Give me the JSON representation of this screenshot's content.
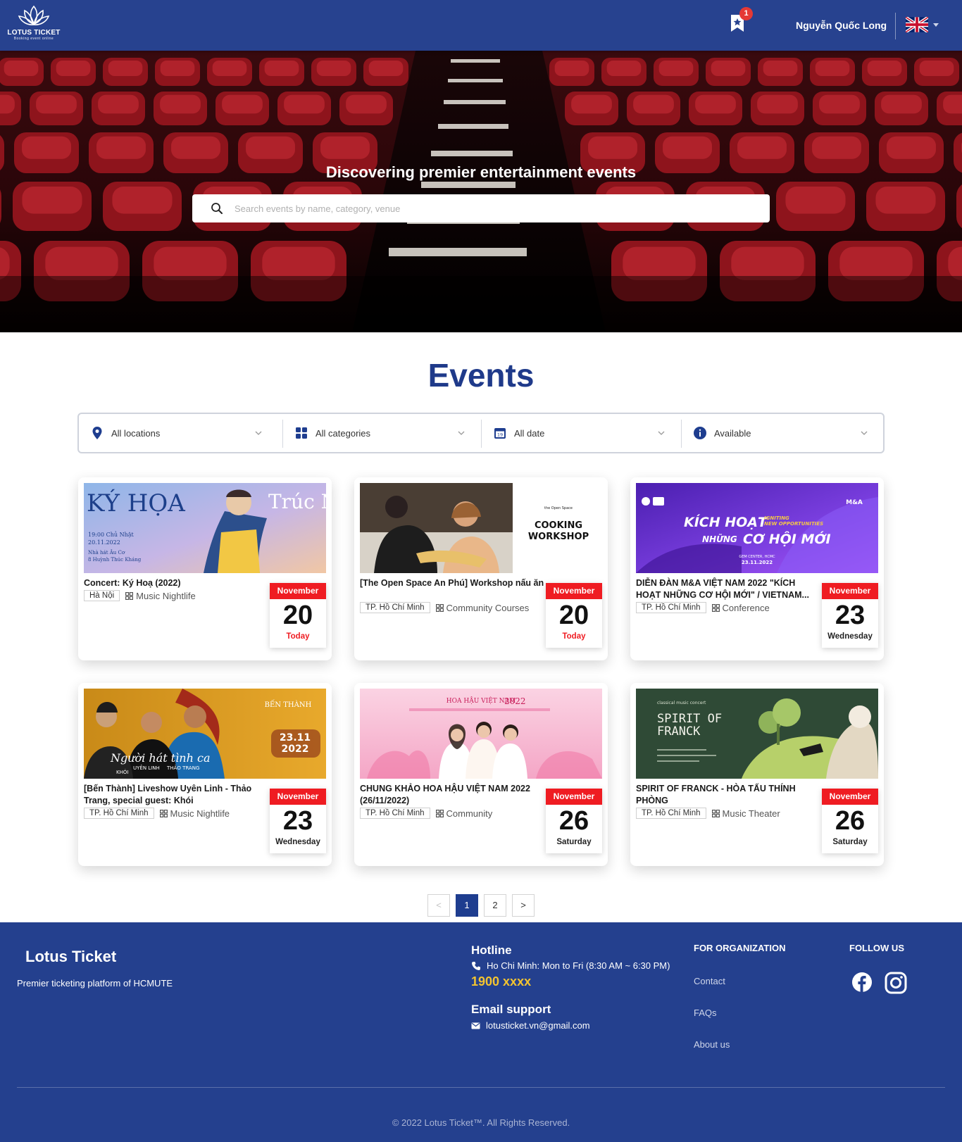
{
  "header": {
    "logo_title": "LOTUS TICKET",
    "logo_subtitle": "Booking event online",
    "wishlist_count": "1",
    "user_name": "Nguyễn Quốc Long",
    "language_icon": "uk-flag-icon"
  },
  "hero": {
    "title": "Discovering premier entertainment events",
    "search_placeholder": "Search events by name, category, venue"
  },
  "events": {
    "title": "Events",
    "filters": [
      {
        "label": "All locations",
        "icon": "location-pin-icon"
      },
      {
        "label": "All categories",
        "icon": "grid-icon"
      },
      {
        "label": "All date",
        "icon": "calendar-icon",
        "icon_text": "19"
      },
      {
        "label": "Available",
        "icon": "info-icon"
      }
    ],
    "cards": [
      {
        "title": "Concert: Ký Hoạ (2022)",
        "location": "Hà Nội",
        "category": "Music Nightlife",
        "month": "November",
        "day": "20",
        "note": "Today",
        "img": {
          "lines": [
            "KÝ HỌA",
            "Trúc Nhân",
            "19:00 Chủ Nhật",
            "20.11.2022",
            "Nhà hát Âu Cơ",
            "8 Huỳnh Thúc Kháng"
          ]
        }
      },
      {
        "title": "[The Open Space An Phú] Workshop nấu ăn",
        "location": "TP. Hồ Chí Minh",
        "category": "Community Courses",
        "month": "November",
        "day": "20",
        "note": "Today",
        "img": {
          "lines": [
            "COOKING",
            "WORKSHOP",
            "the Open Space"
          ]
        }
      },
      {
        "title": "DIỄN ĐÀN M&A VIỆT NAM 2022 \"KÍCH HOẠT NHỮNG CƠ HỘI MỚI\" / VIETNAM...",
        "location": "TP. Hồ Chí Minh",
        "category": "Conference",
        "month": "November",
        "day": "23",
        "note": "Wednesday",
        "img": {
          "lines": [
            "KÍCH HOẠT",
            "NHỮNG",
            "CƠ HỘI MỚI",
            "IGNITING",
            "NEW OPPORTUNITIES",
            "23.11.2022",
            "GEM CENTER, HCMC",
            "M&A"
          ]
        }
      },
      {
        "title": "[Bến Thành] Liveshow Uyên Linh - Thảo Trang, special guest: Khói",
        "location": "TP. Hồ Chí Minh",
        "category": "Music Nightlife",
        "month": "November",
        "day": "23",
        "note": "Wednesday",
        "img": {
          "lines": [
            "BẾN THÀNH",
            "23.11",
            "2022",
            "Người hát tình ca",
            "KHÓI",
            "UYÊN LINH",
            "THẢO TRANG"
          ]
        }
      },
      {
        "title": "CHUNG KHẢO HOA HẬU VIỆT NAM 2022 (26/11/2022)",
        "location": "TP. Hồ Chí Minh",
        "category": "Community",
        "month": "November",
        "day": "26",
        "note": "Saturday",
        "img": {
          "lines": [
            "HOA HẬU VIỆT NAM",
            "2022"
          ]
        }
      },
      {
        "title": "SPIRIT OF FRANCK - HÒA TẤU THÍNH PHÒNG",
        "location": "TP. Hồ Chí Minh",
        "category": "Music Theater",
        "month": "November",
        "day": "26",
        "note": "Saturday",
        "img": {
          "lines": [
            "SPIRIT OF",
            "FRANCK",
            "classical music concert"
          ]
        }
      }
    ],
    "pagination": {
      "prev": "<",
      "pages": [
        "1",
        "2"
      ],
      "next": ">",
      "current": "1"
    }
  },
  "footer": {
    "brand": "Lotus Ticket",
    "tagline": "Premier ticketing platform of HCMUTE",
    "hotline_title": "Hotline",
    "hotline_hours": "Ho Chi Minh: Mon to Fri (8:30 AM ~ 6:30 PM)",
    "hotline_number": "1900 xxxx",
    "email_title": "Email support",
    "email": "lotusticket.vn@gmail.com",
    "org_title": "FOR ORGANIZATION",
    "links": [
      "Contact",
      "FAQs",
      "About us"
    ],
    "follow_title": "FOLLOW US",
    "social": [
      "facebook-icon",
      "instagram-icon"
    ],
    "copyright": "© 2022 Lotus Ticket™. All Rights Reserved."
  },
  "colors": {
    "primary": "#27428f",
    "accent_red": "#ef1c22",
    "footer_bg": "#24408e",
    "hotline": "#f4c430"
  }
}
